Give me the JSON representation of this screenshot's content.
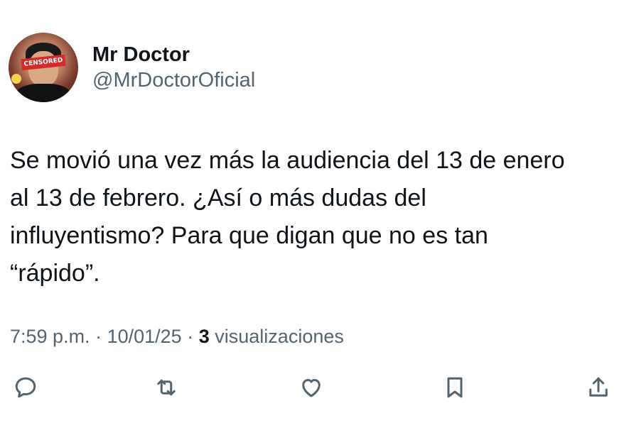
{
  "author": {
    "display_name": "Mr Doctor",
    "handle": "@MrDoctorOficial",
    "avatar_badge": "CENSORED"
  },
  "tweet": {
    "text": "Se movió una vez más la audiencia del 13 de enero\nal 13 de febrero. ¿Así o más dudas del\ninfluyentismo? Para que digan que no es tan\n“rápido”.",
    "time": "7:59 p.m.",
    "separator": "·",
    "date": "10/01/25",
    "views_count": "3",
    "views_label": "visualizaciones"
  },
  "actions": [
    {
      "name": "reply",
      "icon": "reply-icon"
    },
    {
      "name": "retweet",
      "icon": "retweet-icon"
    },
    {
      "name": "like",
      "icon": "heart-icon"
    },
    {
      "name": "bookmark",
      "icon": "bookmark-icon"
    },
    {
      "name": "share",
      "icon": "share-icon"
    }
  ],
  "colors": {
    "text_primary": "#0f1419",
    "text_secondary": "#536471",
    "background": "#ffffff"
  }
}
